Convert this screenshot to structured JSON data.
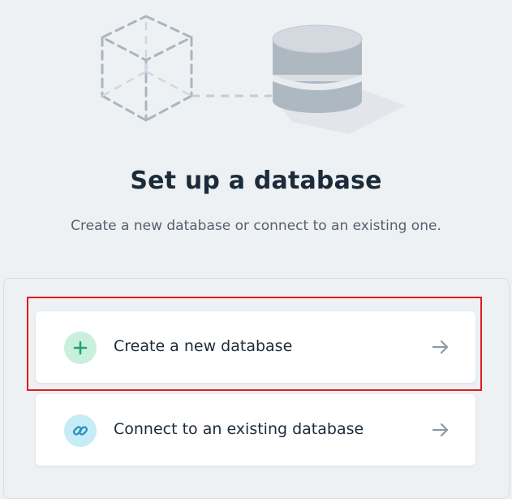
{
  "header": {
    "title": "Set up a database",
    "subtitle": "Create a new database or connect to an existing one."
  },
  "illustration": {
    "icons": [
      "dashed-cube-icon",
      "database-cylinder-icon"
    ]
  },
  "options": [
    {
      "label": "Create a new database",
      "icon": "plus-icon",
      "icon_color": "#1aa86a",
      "icon_bg": "#c9f0dd"
    },
    {
      "label": "Connect to an existing database",
      "icon": "link-icon",
      "icon_color": "#2a8fbf",
      "icon_bg": "#c6ecf6"
    }
  ],
  "colors": {
    "background": "#eef1f4",
    "card": "#ffffff",
    "text_primary": "#1c2b3a",
    "text_secondary": "#55616d",
    "highlight": "#e11c1c"
  }
}
